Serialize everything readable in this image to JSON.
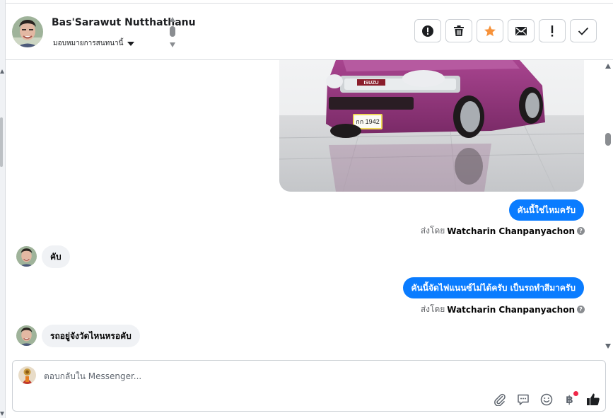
{
  "header": {
    "contact_name": "Bas'Sarawut Nutthathanu",
    "assign_label": "มอบหมายการสนทนานี้",
    "actions": [
      {
        "name": "spam-button",
        "icon": "alert-circle-icon"
      },
      {
        "name": "delete-button",
        "icon": "trash-icon"
      },
      {
        "name": "star-button",
        "icon": "star-icon"
      },
      {
        "name": "mark-unread-button",
        "icon": "envelope-icon"
      },
      {
        "name": "follow-up-button",
        "icon": "exclamation-icon"
      },
      {
        "name": "mark-done-button",
        "icon": "check-icon"
      }
    ]
  },
  "thread": {
    "messages": [
      {
        "direction": "outgoing",
        "text": "คันนี้ใช่ไหมครับ",
        "sent_by_label": "ส่งโดย",
        "sender": "Watcharin Chanpanyachon"
      },
      {
        "direction": "incoming",
        "text": "คับ"
      },
      {
        "direction": "outgoing",
        "text": "คันนี้จัดไฟแนนซ์ไม่ได้ครับ เป็นรถทำสีมาครับ",
        "sent_by_label": "ส่งโดย",
        "sender": "Watcharin Chanpanyachon"
      },
      {
        "direction": "incoming",
        "text": "รถอยู่จังวัดไหนหรอคับ"
      }
    ],
    "image": {
      "plate_text": "กก 1942",
      "brand_badge": "ISUZU"
    }
  },
  "composer": {
    "placeholder": "ตอบกลับใน Messenger...",
    "tools": [
      "paperclip-icon",
      "saved-reply-icon",
      "emoji-icon",
      "baht-icon",
      "thumbs-up-icon"
    ],
    "baht_symbol": "฿"
  },
  "colors": {
    "outgoing_bubble": "#0a7cff",
    "incoming_bubble": "#f0f2f5",
    "star_active": "#f7923a",
    "notification_dot": "#f02849"
  }
}
